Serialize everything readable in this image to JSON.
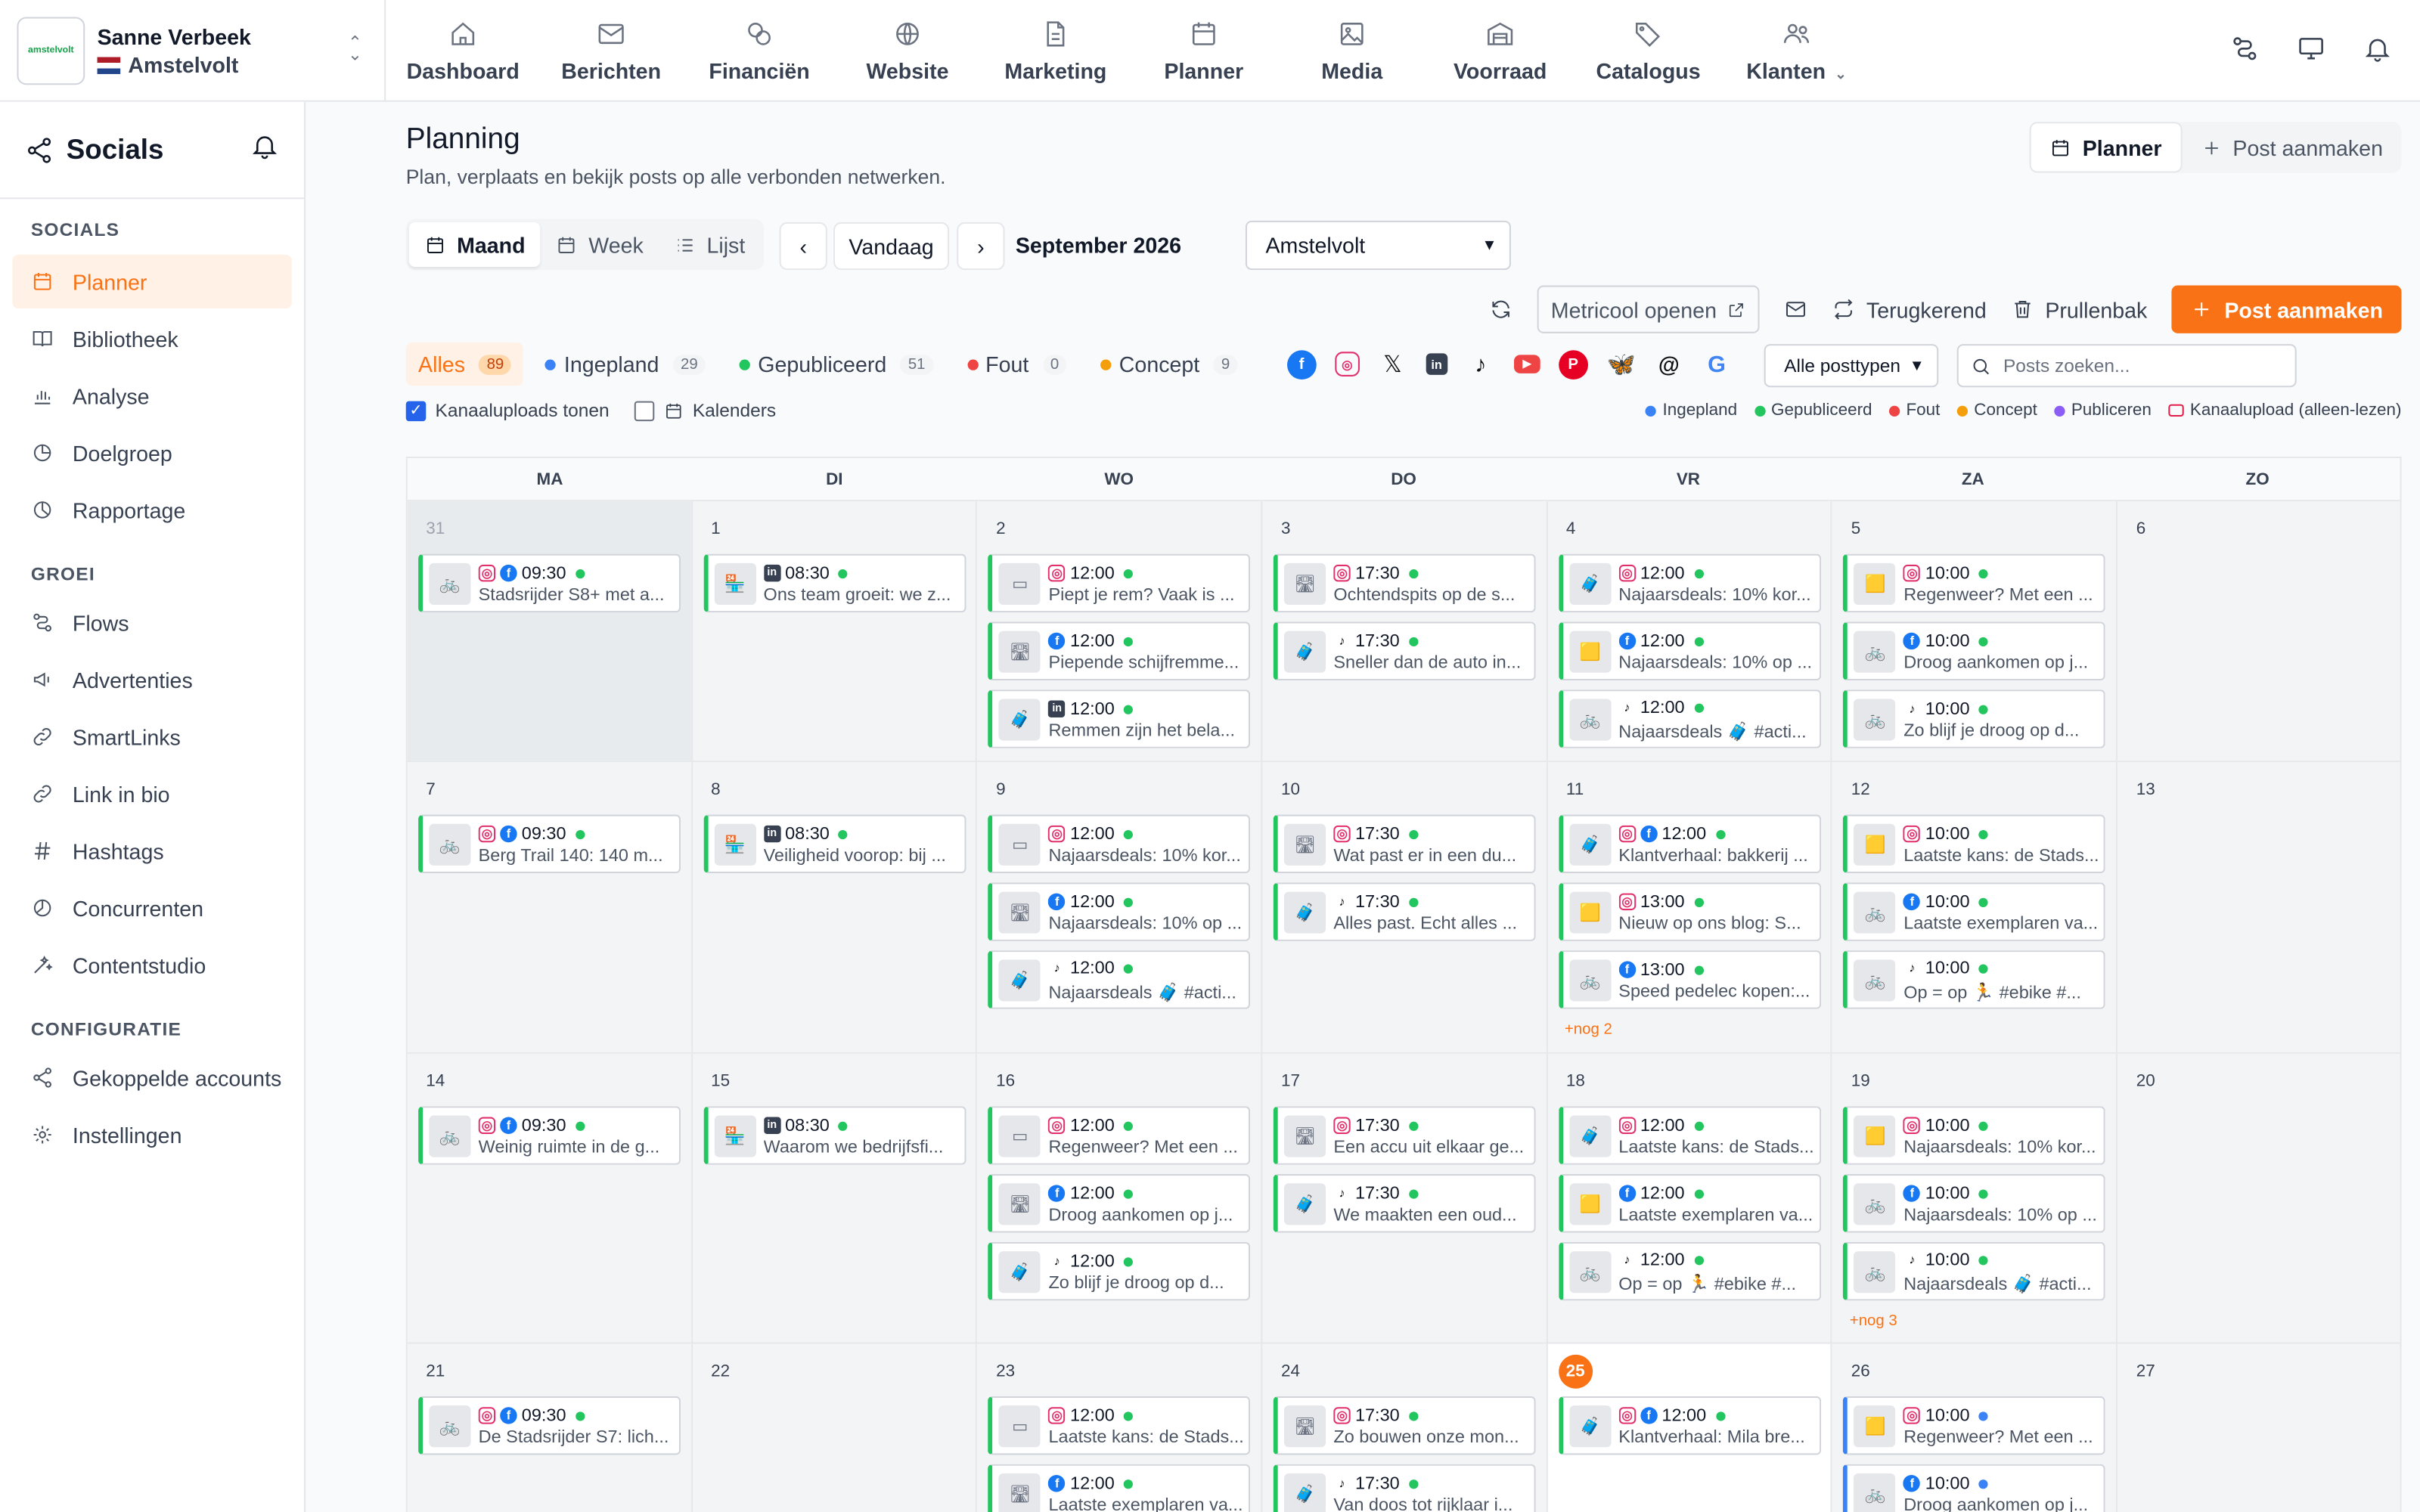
{
  "account": {
    "name": "Sanne Verbeek",
    "location": "Amstelvolt",
    "logo_text": "amstelvolt"
  },
  "topnav": [
    {
      "label": "Dashboard",
      "icon": "home-icon"
    },
    {
      "label": "Berichten",
      "icon": "mail-icon"
    },
    {
      "label": "Financiën",
      "icon": "coins-icon"
    },
    {
      "label": "Website",
      "icon": "globe-icon"
    },
    {
      "label": "Marketing",
      "icon": "document-icon"
    },
    {
      "label": "Planner",
      "icon": "calendar-icon"
    },
    {
      "label": "Media",
      "icon": "image-icon"
    },
    {
      "label": "Voorraad",
      "icon": "warehouse-icon"
    },
    {
      "label": "Catalogus",
      "icon": "tags-icon"
    },
    {
      "label": "Klanten",
      "icon": "users-icon"
    }
  ],
  "sidebar": {
    "title": "Socials",
    "sections": [
      {
        "title": "SOCIALS",
        "items": [
          {
            "label": "Planner",
            "active": true
          },
          {
            "label": "Bibliotheek"
          },
          {
            "label": "Analyse"
          },
          {
            "label": "Doelgroep"
          },
          {
            "label": "Rapportage"
          }
        ]
      },
      {
        "title": "GROEI",
        "items": [
          {
            "label": "Flows"
          },
          {
            "label": "Advertenties"
          },
          {
            "label": "SmartLinks"
          },
          {
            "label": "Link in bio"
          },
          {
            "label": "Hashtags"
          },
          {
            "label": "Concurrenten"
          },
          {
            "label": "Contentstudio"
          }
        ]
      },
      {
        "title": "CONFIGURATIE",
        "items": [
          {
            "label": "Gekoppelde accounts"
          },
          {
            "label": "Instellingen"
          }
        ]
      }
    ]
  },
  "page": {
    "title": "Planning",
    "subtitle": "Plan, verplaats en bekijk posts op alle verbonden netwerken.",
    "planner_btn": "Planner",
    "create_btn": "Post aanmaken",
    "views": [
      "Maand",
      "Week",
      "Lijst"
    ],
    "today": "Vandaag",
    "month": "September 2026",
    "location_select": "Amstelvolt",
    "metricool": "Metricool openen",
    "recurring": "Terugkerend",
    "trash": "Prullenbak",
    "create_post": "Post aanmaken",
    "filters": [
      {
        "label": "Alles",
        "count": "89",
        "color": ""
      },
      {
        "label": "Ingepland",
        "count": "29",
        "color": "#3b82f6"
      },
      {
        "label": "Gepubliceerd",
        "count": "51",
        "color": "#22c55e"
      },
      {
        "label": "Fout",
        "count": "0",
        "color": "#ef4444"
      },
      {
        "label": "Concept",
        "count": "9",
        "color": "#f59e0b"
      }
    ],
    "post_types": "Alle posttypen",
    "search_placeholder": "Posts zoeken...",
    "show_uploads": "Kanaaluploads tonen",
    "calendars": "Kalenders",
    "legend": [
      {
        "label": "Ingepland",
        "color": "#3b82f6"
      },
      {
        "label": "Gepubliceerd",
        "color": "#22c55e"
      },
      {
        "label": "Fout",
        "color": "#ef4444"
      },
      {
        "label": "Concept",
        "color": "#f59e0b"
      },
      {
        "label": "Publiceren",
        "color": "#8b5cf6"
      },
      {
        "label": "Kanaalupload (alleen-lezen)",
        "color": "#e11d48"
      }
    ]
  },
  "calendar": {
    "weekdays": [
      "MA",
      "DI",
      "WO",
      "DO",
      "VR",
      "ZA",
      "ZO"
    ],
    "weeks": [
      [
        {
          "day": "31",
          "muted": true,
          "posts": [
            {
              "nets": [
                "ig",
                "fb"
              ],
              "time": "09:30",
              "text": "Stadsrijder S8+ met a..."
            }
          ]
        },
        {
          "day": "1",
          "posts": [
            {
              "nets": [
                "li"
              ],
              "time": "08:30",
              "text": "Ons team groeit: we z..."
            }
          ]
        },
        {
          "day": "2",
          "posts": [
            {
              "nets": [
                "ig"
              ],
              "time": "12:00",
              "text": "Piept je rem? Vaak is ..."
            },
            {
              "nets": [
                "fb"
              ],
              "time": "12:00",
              "text": "Piepende schijfremme..."
            },
            {
              "nets": [
                "li"
              ],
              "time": "12:00",
              "text": "Remmen zijn het bela..."
            }
          ]
        },
        {
          "day": "3",
          "posts": [
            {
              "nets": [
                "ig"
              ],
              "time": "17:30",
              "text": "Ochtendspits op de s..."
            },
            {
              "nets": [
                "tt"
              ],
              "time": "17:30",
              "text": "Sneller dan de auto in..."
            }
          ]
        },
        {
          "day": "4",
          "posts": [
            {
              "nets": [
                "ig"
              ],
              "time": "12:00",
              "text": "Najaarsdeals: 10% kor..."
            },
            {
              "nets": [
                "fb"
              ],
              "time": "12:00",
              "text": "Najaarsdeals: 10% op ..."
            },
            {
              "nets": [
                "tt"
              ],
              "time": "12:00",
              "text": "Najaarsdeals 🧳 #acti..."
            }
          ]
        },
        {
          "day": "5",
          "posts": [
            {
              "nets": [
                "ig"
              ],
              "time": "10:00",
              "text": "Regenweer? Met een ..."
            },
            {
              "nets": [
                "fb"
              ],
              "time": "10:00",
              "text": "Droog aankomen op j..."
            },
            {
              "nets": [
                "tt"
              ],
              "time": "10:00",
              "text": "Zo blijf je droog op d..."
            }
          ]
        },
        {
          "day": "6",
          "posts": []
        }
      ],
      [
        {
          "day": "7",
          "posts": [
            {
              "nets": [
                "ig",
                "fb"
              ],
              "time": "09:30",
              "text": "Berg Trail 140: 140 m..."
            }
          ]
        },
        {
          "day": "8",
          "posts": [
            {
              "nets": [
                "li"
              ],
              "time": "08:30",
              "text": "Veiligheid voorop: bij ..."
            }
          ]
        },
        {
          "day": "9",
          "posts": [
            {
              "nets": [
                "ig"
              ],
              "time": "12:00",
              "text": "Najaarsdeals: 10% kor..."
            },
            {
              "nets": [
                "fb"
              ],
              "time": "12:00",
              "text": "Najaarsdeals: 10% op ..."
            },
            {
              "nets": [
                "tt"
              ],
              "time": "12:00",
              "text": "Najaarsdeals 🧳 #acti..."
            }
          ]
        },
        {
          "day": "10",
          "posts": [
            {
              "nets": [
                "ig"
              ],
              "time": "17:30",
              "text": "Wat past er in een du..."
            },
            {
              "nets": [
                "tt"
              ],
              "time": "17:30",
              "text": "Alles past. Echt alles ..."
            }
          ]
        },
        {
          "day": "11",
          "more": "+nog 2",
          "posts": [
            {
              "nets": [
                "ig",
                "fb"
              ],
              "time": "12:00",
              "text": "Klantverhaal: bakkerij ..."
            },
            {
              "nets": [
                "ig"
              ],
              "time": "13:00",
              "text": "Nieuw op ons blog: S..."
            },
            {
              "nets": [
                "fb"
              ],
              "time": "13:00",
              "text": "Speed pedelec kopen:..."
            }
          ]
        },
        {
          "day": "12",
          "posts": [
            {
              "nets": [
                "ig"
              ],
              "time": "10:00",
              "text": "Laatste kans: de Stads..."
            },
            {
              "nets": [
                "fb"
              ],
              "time": "10:00",
              "text": "Laatste exemplaren va..."
            },
            {
              "nets": [
                "tt"
              ],
              "time": "10:00",
              "text": "Op = op 🏃 #ebike #..."
            }
          ]
        },
        {
          "day": "13",
          "posts": []
        }
      ],
      [
        {
          "day": "14",
          "posts": [
            {
              "nets": [
                "ig",
                "fb"
              ],
              "time": "09:30",
              "text": "Weinig ruimte in de g..."
            }
          ]
        },
        {
          "day": "15",
          "posts": [
            {
              "nets": [
                "li"
              ],
              "time": "08:30",
              "text": "Waarom we bedrijfsfi..."
            }
          ]
        },
        {
          "day": "16",
          "posts": [
            {
              "nets": [
                "ig"
              ],
              "time": "12:00",
              "text": "Regenweer? Met een ..."
            },
            {
              "nets": [
                "fb"
              ],
              "time": "12:00",
              "text": "Droog aankomen op j..."
            },
            {
              "nets": [
                "tt"
              ],
              "time": "12:00",
              "text": "Zo blijf je droog op d..."
            }
          ]
        },
        {
          "day": "17",
          "posts": [
            {
              "nets": [
                "ig"
              ],
              "time": "17:30",
              "text": "Een accu uit elkaar ge..."
            },
            {
              "nets": [
                "tt"
              ],
              "time": "17:30",
              "text": "We maakten een oud..."
            }
          ]
        },
        {
          "day": "18",
          "posts": [
            {
              "nets": [
                "ig"
              ],
              "time": "12:00",
              "text": "Laatste kans: de Stads..."
            },
            {
              "nets": [
                "fb"
              ],
              "time": "12:00",
              "text": "Laatste exemplaren va..."
            },
            {
              "nets": [
                "tt"
              ],
              "time": "12:00",
              "text": "Op = op 🏃 #ebike #..."
            }
          ]
        },
        {
          "day": "19",
          "more": "+nog 3",
          "posts": [
            {
              "nets": [
                "ig"
              ],
              "time": "10:00",
              "text": "Najaarsdeals: 10% kor..."
            },
            {
              "nets": [
                "fb"
              ],
              "time": "10:00",
              "text": "Najaarsdeals: 10% op ..."
            },
            {
              "nets": [
                "tt"
              ],
              "time": "10:00",
              "text": "Najaarsdeals 🧳 #acti..."
            }
          ]
        },
        {
          "day": "20",
          "posts": []
        }
      ],
      [
        {
          "day": "21",
          "posts": [
            {
              "nets": [
                "ig",
                "fb"
              ],
              "time": "09:30",
              "text": "De Stadsrijder S7: lich..."
            }
          ]
        },
        {
          "day": "22",
          "posts": []
        },
        {
          "day": "23",
          "posts": [
            {
              "nets": [
                "ig"
              ],
              "time": "12:00",
              "text": "Laatste kans: de Stads..."
            },
            {
              "nets": [
                "fb"
              ],
              "time": "12:00",
              "text": "Laatste exemplaren va..."
            }
          ]
        },
        {
          "day": "24",
          "posts": [
            {
              "nets": [
                "ig"
              ],
              "time": "17:30",
              "text": "Zo bouwen onze mon..."
            },
            {
              "nets": [
                "tt"
              ],
              "time": "17:30",
              "text": "Van doos tot rijklaar i..."
            }
          ]
        },
        {
          "day": "25",
          "today": true,
          "posts": [
            {
              "nets": [
                "ig",
                "fb"
              ],
              "time": "12:00",
              "text": "Klantverhaal: Mila bre..."
            }
          ]
        },
        {
          "day": "26",
          "planned": true,
          "posts": [
            {
              "nets": [
                "ig"
              ],
              "time": "10:00",
              "text": "Regenweer? Met een ..."
            },
            {
              "nets": [
                "fb"
              ],
              "time": "10:00",
              "text": "Droog aankomen op j..."
            }
          ]
        },
        {
          "day": "27",
          "posts": []
        }
      ]
    ]
  }
}
